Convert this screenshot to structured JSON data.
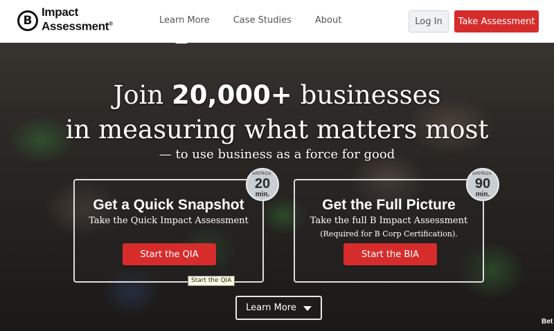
{
  "header": {
    "logo_mark": "B",
    "logo_line1": "Impact",
    "logo_line2": "Assessment",
    "logo_reg": "®",
    "nav": [
      "Learn More",
      "Case Studies",
      "About"
    ],
    "login_label": "Log In",
    "take_assessment_label": "Take Assessment"
  },
  "hero": {
    "headline_pre": "Join",
    "headline_bold": "20,000+",
    "headline_post": "businesses",
    "headline_line2": "in measuring what matters most",
    "tagline": "— to use business as a force for good",
    "learn_more_label": "Learn More",
    "corner_text": "Bet"
  },
  "cards": {
    "qia": {
      "badge_approx": "APPROX.",
      "badge_number": "20",
      "badge_unit": "min.",
      "title": "Get a Quick Snapshot",
      "subtitle": "Take the Quick Impact Assessment",
      "button_label": "Start the QIA",
      "tooltip": "Start the QIA"
    },
    "bia": {
      "badge_approx": "APPROX.",
      "badge_number": "90",
      "badge_unit": "min.",
      "title": "Get the Full Picture",
      "subtitle": "Take the full B Impact Assessment",
      "note": "(Required for B Corp Certification).",
      "button_label": "Start the BIA"
    }
  },
  "colors": {
    "accent_red": "#d62c2c",
    "login_bg": "#eef2f5",
    "badge_bg": "#c9ced2"
  },
  "icons": {
    "learn_more_icon": "chevron-down-icon",
    "logo_icon": "b-corp-logo"
  }
}
